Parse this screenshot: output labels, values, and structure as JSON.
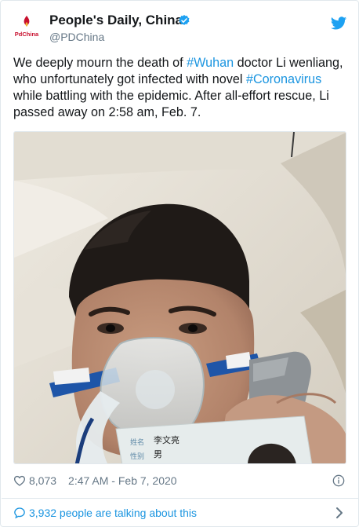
{
  "account": {
    "name": "People's Daily, China",
    "handle": "@PDChina",
    "avatar_text": "PdChina",
    "verified_icon": "verified-badge-icon",
    "platform_icon": "twitter-bird-icon"
  },
  "tweet": {
    "text_parts": [
      {
        "text": "We deeply mourn the death of ",
        "type": "text"
      },
      {
        "text": "#Wuhan",
        "type": "hashtag"
      },
      {
        "text": " doctor Li wenliang, who unfortunately got infected with novel ",
        "type": "text"
      },
      {
        "text": "#Coronavirus",
        "type": "hashtag"
      },
      {
        "text": " while battling with the epidemic. After all-effort rescue, Li passed away on 2:58 am, Feb. 7.",
        "type": "text"
      }
    ],
    "id_card": {
      "label_name": "姓名",
      "name_value": "李文亮",
      "label_sex": "性别",
      "sex_value": "男"
    }
  },
  "footer": {
    "likes": "8,073",
    "timestamp": "2:47 AM - Feb 7, 2020",
    "talking": "3,932 people are talking about this"
  },
  "colors": {
    "link": "#1b95e0",
    "muted": "#657786",
    "brand_red": "#c8102e"
  }
}
